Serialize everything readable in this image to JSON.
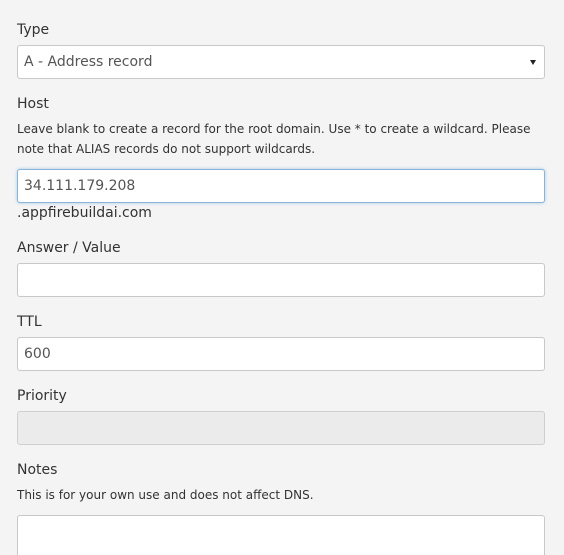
{
  "type": {
    "label": "Type",
    "selected": "A - Address record"
  },
  "host": {
    "label": "Host",
    "help": "Leave blank to create a record for the root domain. Use * to create a wildcard. Please note that ALIAS records do not support wildcards.",
    "value": "34.111.179.208",
    "suffix": ".appfirebuildai.com"
  },
  "answer": {
    "label": "Answer / Value",
    "value": ""
  },
  "ttl": {
    "label": "TTL",
    "value": "600"
  },
  "priority": {
    "label": "Priority",
    "value": ""
  },
  "notes": {
    "label": "Notes",
    "help": "This is for your own use and does not affect DNS.",
    "value": ""
  }
}
